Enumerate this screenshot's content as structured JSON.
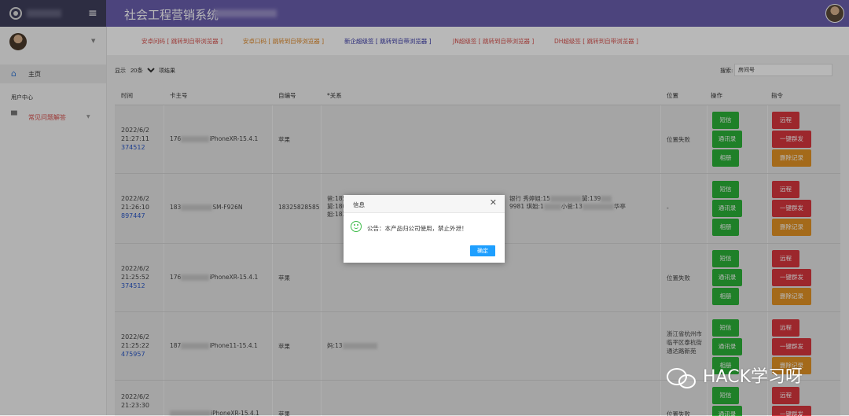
{
  "app_title": "社会工程营销系统",
  "link_bar": [
    {
      "label": "安卓问码 [ 跳转到自带浏览器 ]",
      "color": "#d9534f"
    },
    {
      "label": "安卓口码 [ 跳转到自带浏览器 ]",
      "color": "#e08a2a"
    },
    {
      "label": "新企超级签 [ 跳转到自带浏览器 ]",
      "color": "#3a3aa8"
    },
    {
      "label": "JN超级签 [ 跳转到自带浏览器 ]",
      "color": "#d9534f"
    },
    {
      "label": "DH超级签 [ 跳转到自带浏览器 ]",
      "color": "#d9534f"
    }
  ],
  "sidebar": {
    "home": "主页",
    "user_center": "用户中心",
    "faq": "常见问题解答"
  },
  "table_controls": {
    "show_label": "显示",
    "page_size": "20条",
    "page_size_options": [
      "20条"
    ],
    "result_suffix": "项结果",
    "search_label": "搜索:",
    "search_placeholder": "房间号"
  },
  "columns": [
    "时间",
    "卡主号",
    "自编号",
    "*关系",
    "位置",
    "操作",
    "指令"
  ],
  "rows": [
    {
      "date": "2022/6/2",
      "time": "21:27:11",
      "id": "374512",
      "model_prefix": "176",
      "model": "iPhoneXR-15.4.1",
      "self_no": "苹果",
      "relation_lines": [],
      "location": "位置失败"
    },
    {
      "date": "2022/6/2",
      "time": "21:26:10",
      "id": "897447",
      "model_prefix": "183",
      "model": "SM-F926N",
      "self_no": "18325828585",
      "relation_lines": [
        "爸:185",
        "舅:180",
        "姐:183"
      ],
      "relation_right": [
        "银行 秀婷姐:15",
        "舅:139",
        "9981 琪姐:1",
        "小爸:13",
        "华亭"
      ],
      "location": "-"
    },
    {
      "date": "2022/6/2",
      "time": "21:25:52",
      "id": "374512",
      "model_prefix": "176",
      "model": "iPhoneXR-15.4.1",
      "self_no": "苹果",
      "relation_lines": [],
      "location": "位置失败"
    },
    {
      "date": "2022/6/2",
      "time": "21:25:22",
      "id": "475957",
      "model_prefix": "187",
      "model": "iPhone11-15.4.1",
      "self_no": "苹果",
      "relation_lines": [
        "妈:13"
      ],
      "location": "浙江省杭州市临平区泰杭街通达路新苑"
    },
    {
      "date": "2022/6/2",
      "time": "21:23:30",
      "id": "",
      "model_prefix": "",
      "model": "iPhoneXR-15.4.1",
      "self_no": "苹果",
      "relation_lines": [],
      "location": "位置失败"
    }
  ],
  "actions": {
    "sms": "短信",
    "contacts": "通讯录",
    "album": "相册",
    "remote": "远程",
    "mass_send": "一键群发",
    "delete_records": "删除记录"
  },
  "dialog": {
    "title": "信息",
    "message": "公告：本产品归公司使用，禁止外泄！",
    "ok": "确定"
  },
  "watermark": "HACK学习呀",
  "colors": {
    "topbar": "#6a5fae",
    "green_button": "#2cb238",
    "red_button": "#d9363e",
    "orange_button": "#e39425",
    "dialog_ok": "#1e9fff"
  }
}
